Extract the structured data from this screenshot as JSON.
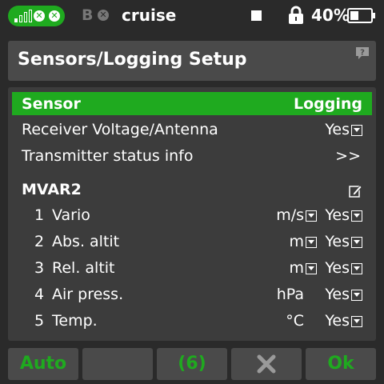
{
  "statusbar": {
    "bind_letter": "B",
    "bind_status_icon": "x-circle-icon",
    "model_name": "cruise",
    "battery_percent": "40%",
    "battery_level": 0.4,
    "signal_icon": "signal-bars-icon",
    "lock_icon": "lock-icon",
    "accent_color": "#1faa1f"
  },
  "title": {
    "text": "Sensors/Logging Setup",
    "help_icon": "help-question-icon"
  },
  "list": {
    "header": {
      "left": "Sensor",
      "right": "Logging"
    },
    "rows": [
      {
        "label": "Receiver Voltage/Antenna",
        "logging": "Yes"
      },
      {
        "label": "Transmitter status info",
        "action": ">>"
      }
    ],
    "section": {
      "title": "MVAR2",
      "edit_icon": "edit-pencil-icon"
    },
    "sensors": [
      {
        "num": "1",
        "name": "Vario",
        "unit": "m/s",
        "logging": "Yes"
      },
      {
        "num": "2",
        "name": "Abs. altit",
        "unit": "m",
        "logging": "Yes"
      },
      {
        "num": "3",
        "name": "Rel. altit",
        "unit": "m",
        "logging": "Yes"
      },
      {
        "num": "4",
        "name": "Air press.",
        "unit": "hPa",
        "logging": "Yes"
      },
      {
        "num": "5",
        "name": "Temp.",
        "unit": "°C",
        "logging": "Yes"
      }
    ]
  },
  "buttons": {
    "auto": "Auto",
    "blank": "",
    "count": "(6)",
    "delete_icon": "x-delete-icon",
    "ok": "Ok"
  }
}
